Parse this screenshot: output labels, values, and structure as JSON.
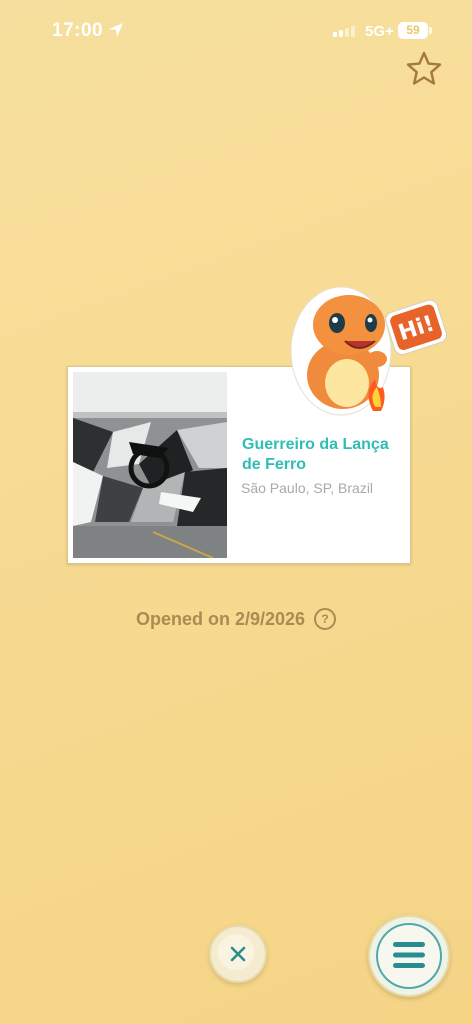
{
  "status_bar": {
    "time": "17:00",
    "network": "5G+",
    "battery": "59",
    "icons": [
      "location-arrow-icon",
      "signal-icon",
      "battery-icon"
    ]
  },
  "favorite": {
    "icon": "star-outline-icon"
  },
  "poi_card": {
    "title": "Guerreiro da Lança de Ferro",
    "location": "São Paulo, SP, Brazil"
  },
  "sticker": {
    "text": "Hi!"
  },
  "opened_text": "Opened on 2/9/2026",
  "help_icon": "?",
  "buttons": {
    "close_icon": "close-icon",
    "menu_icon": "menu-icon"
  },
  "colors": {
    "background": "#f6d98f",
    "title_teal": "#2fbdb5",
    "opened_brown": "#ad8a52",
    "location_gray": "#a9a9a9",
    "button_teal": "#2a8c93"
  }
}
